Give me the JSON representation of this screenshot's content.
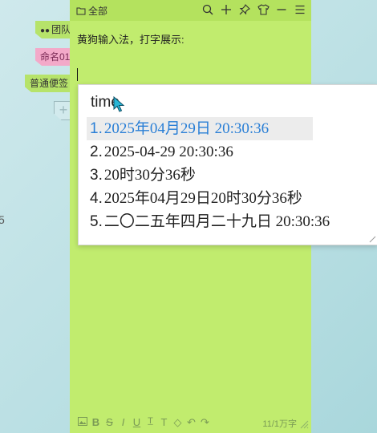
{
  "left_tabs": {
    "team": "团队",
    "name": "命名01",
    "note": "普通便签",
    "add": "+"
  },
  "edge_glyph": "5",
  "note": {
    "folder": "全部",
    "title": "黄狗输入法，打字展示:",
    "footer_count": "11/1万字"
  },
  "ime": {
    "input": "time",
    "candidates": [
      {
        "num": "1.",
        "text": "2025年04月29日  20:30:36"
      },
      {
        "num": "2.",
        "text": "2025-04-29  20:30:36"
      },
      {
        "num": "3.",
        "text": "20时30分36秒"
      },
      {
        "num": "4.",
        "text": "2025年04月29日20时30分36秒"
      },
      {
        "num": "5.",
        "text": "二〇二五年四月二十九日  20:30:36"
      }
    ]
  },
  "colors": {
    "note_bg": "#c1ec6e",
    "header_bg": "#b4e25e",
    "pink_tab": "#f3a9c9",
    "selected_text": "#2a7fd6"
  }
}
